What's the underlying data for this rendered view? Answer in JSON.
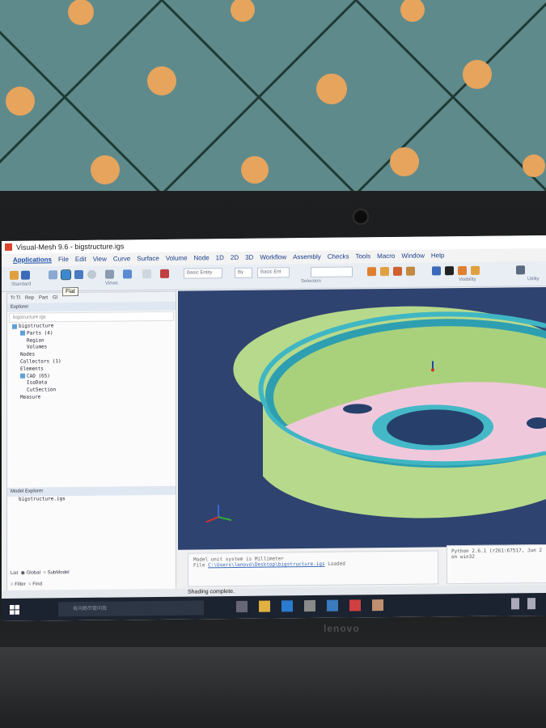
{
  "window": {
    "title": "Visual-Mesh 9.6 - bigstructure.igs"
  },
  "menu": [
    "Applications",
    "File",
    "Edit",
    "View",
    "Curve",
    "Surface",
    "Volume",
    "Node",
    "1D",
    "2D",
    "3D",
    "Workflow",
    "Assembly",
    "Checks",
    "Tools",
    "Macro",
    "Window",
    "Help"
  ],
  "toolbar": {
    "group_labels": {
      "standard": "Standard",
      "views": "Views",
      "selection": "Selection",
      "visibility": "Visibility",
      "utility": "Utility"
    },
    "selects": [
      "Basic Entity",
      "By",
      "Basic Ent"
    ],
    "tooltip": "Flat"
  },
  "explorer": {
    "tabs": [
      "Tr Tl",
      "Rep",
      "Part",
      "Gl"
    ],
    "header": "Explorer",
    "breadcrumb": "bigstructure.igs",
    "tree": [
      "bigstructure",
      "Parts (4)",
      "Region",
      "Volumes",
      "Nodes",
      "Collectors (1)",
      "Elements",
      "CAD (65)",
      "IsoData",
      "CutSection",
      "Measure"
    ],
    "model_explorer_header": "Model Explorer",
    "model_item": "bigstructure.igs",
    "list_label": "List",
    "radio_global": "Global",
    "radio_submodel": "SubModel",
    "filter": "Filter",
    "find": "Find"
  },
  "console": {
    "line1": "Model unit system is Millimeter",
    "line2_prefix": "File",
    "line2_path": "C:\\Users\\lenovo\\Desktop\\bigstructure.igs",
    "line2_suffix": "Loaded",
    "side_line1": "Python 2.6.1 (r261:67517, Jun 2",
    "side_line2": "on win32"
  },
  "status": {
    "text": "Shading complete."
  },
  "taskbar": {
    "search_placeholder": "有问题尽管问我"
  },
  "laptop": {
    "brand": "lenovo"
  },
  "colors": {
    "viewport_bg": "#2e4370",
    "cylinder_green": "#b7d98c",
    "rim_cyan": "#3fb6c4",
    "floor_pink": "#f0c8dc",
    "accent_blue": "#1d4fa8"
  }
}
